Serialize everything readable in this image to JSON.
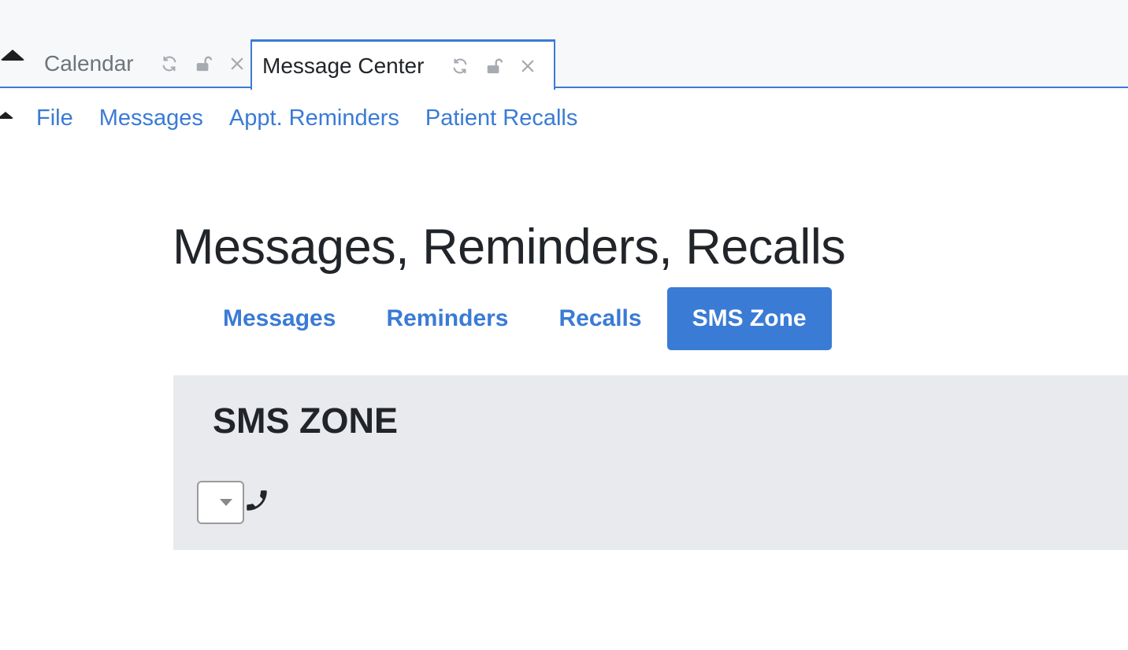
{
  "tabs": [
    {
      "label": "Calendar",
      "active": false
    },
    {
      "label": "Message Center",
      "active": true
    }
  ],
  "tab_icons": [
    "refresh-icon",
    "unlock-icon",
    "close-icon"
  ],
  "menu": {
    "items": [
      "File",
      "Messages",
      "Appt. Reminders",
      "Patient Recalls"
    ]
  },
  "page": {
    "title": "Messages, Reminders, Recalls"
  },
  "nav_pills": {
    "items": [
      "Messages",
      "Reminders",
      "Recalls",
      "SMS Zone"
    ],
    "active": "SMS Zone"
  },
  "sms_zone": {
    "title": "SMS ZONE",
    "phone_select_value": "",
    "phone_icon": "phone-icon"
  },
  "colors": {
    "accent": "#3a7bd5",
    "topbar_bg": "#f7f8fa",
    "zone_bg": "#e9eaed",
    "text": "#212529",
    "muted": "#6c757d"
  }
}
